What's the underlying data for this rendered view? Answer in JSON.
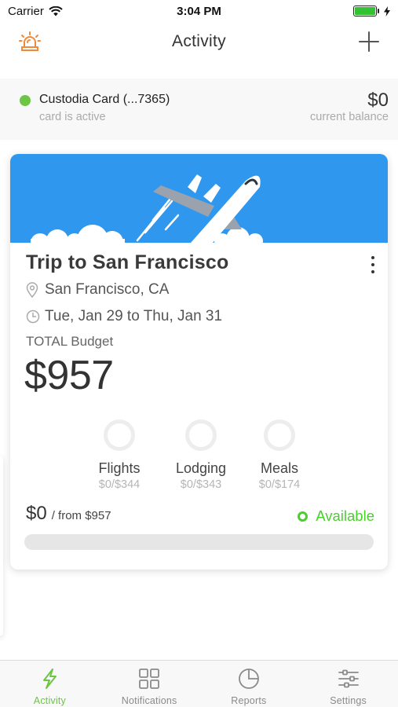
{
  "status_bar": {
    "carrier": "Carrier",
    "time": "3:04 PM",
    "battery_level": 1.0
  },
  "nav": {
    "title": "Activity",
    "left_icon": "alarm-light-icon",
    "right_icon": "plus-icon"
  },
  "account": {
    "name": "Custodia Card (...7365)",
    "status": "card is active",
    "balance": "$0",
    "balance_label": "current balance",
    "status_color": "#6cc644"
  },
  "trip": {
    "title": "Trip to San Francisco",
    "location": "San Francisco, CA",
    "dates": "Tue, Jan 29 to Thu, Jan 31",
    "budget_label": "TOTAL Budget",
    "budget_value": "$957",
    "categories": [
      {
        "name": "Flights",
        "amount": "$0/$344"
      },
      {
        "name": "Lodging",
        "amount": "$0/$343"
      },
      {
        "name": "Meals",
        "amount": "$0/$174"
      }
    ],
    "spent": "$0",
    "spent_of": "/ from $957",
    "availability": "Available",
    "progress_fraction": 0,
    "hero_color": "#2f97ee",
    "available_color": "#47d12a"
  },
  "tabs": [
    {
      "label": "Activity",
      "icon": "lightning-bolt-icon",
      "active": true
    },
    {
      "label": "Notifications",
      "icon": "grid-icon",
      "active": false
    },
    {
      "label": "Reports",
      "icon": "pie-chart-icon",
      "active": false
    },
    {
      "label": "Settings",
      "icon": "sliders-icon",
      "active": false
    }
  ]
}
